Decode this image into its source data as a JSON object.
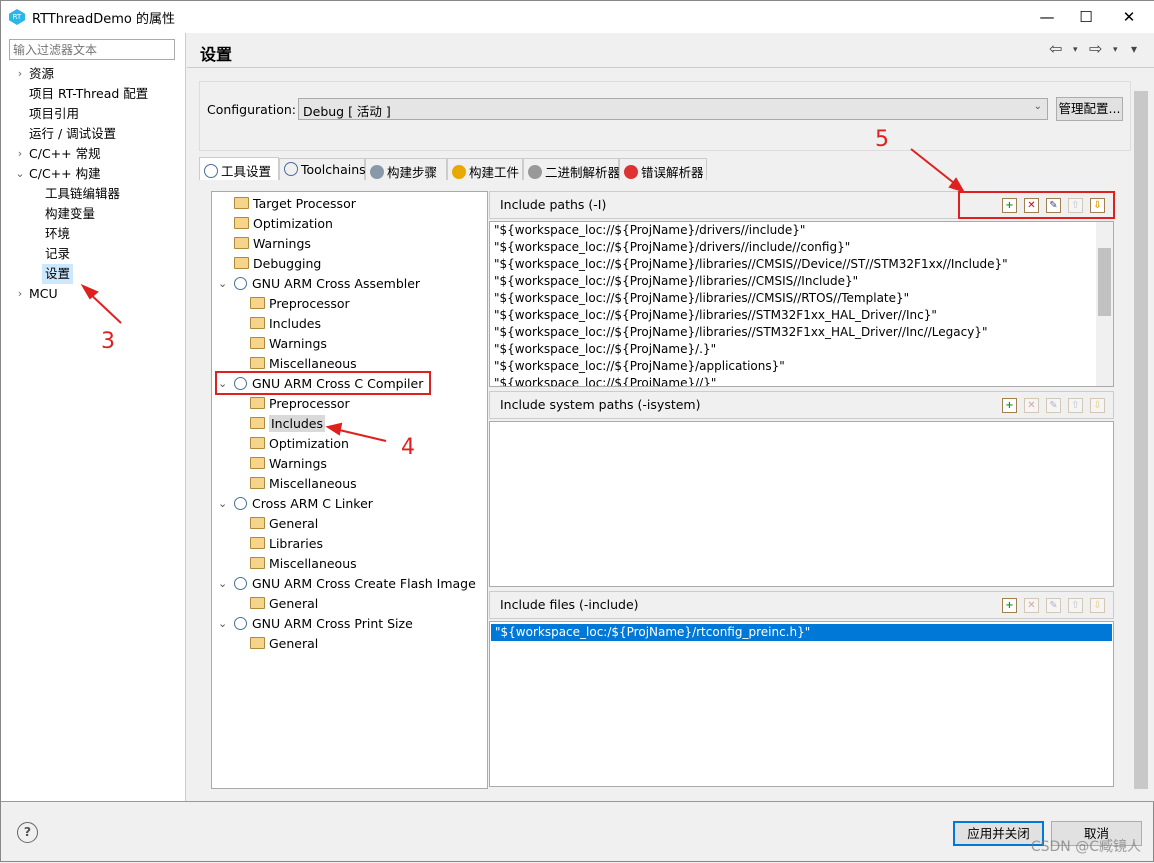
{
  "window": {
    "title": "RTThreadDemo 的属性",
    "minimize": "—",
    "maximize": "☐",
    "close": "✕"
  },
  "filter": {
    "placeholder": "输入过滤器文本"
  },
  "nav": [
    {
      "label": "资源",
      "level": 0,
      "chevron": "›"
    },
    {
      "label": "项目 RT-Thread 配置",
      "level": 0,
      "chevron": ""
    },
    {
      "label": "项目引用",
      "level": 0,
      "chevron": ""
    },
    {
      "label": "运行 / 调试设置",
      "level": 0,
      "chevron": ""
    },
    {
      "label": "C/C++ 常规",
      "level": 0,
      "chevron": "›"
    },
    {
      "label": "C/C++ 构建",
      "level": 0,
      "chevron": "⌄"
    },
    {
      "label": "工具链编辑器",
      "level": 1,
      "chevron": ""
    },
    {
      "label": "构建变量",
      "level": 1,
      "chevron": ""
    },
    {
      "label": "环境",
      "level": 1,
      "chevron": ""
    },
    {
      "label": "记录",
      "level": 1,
      "chevron": ""
    },
    {
      "label": "设置",
      "level": 1,
      "chevron": "",
      "selected": true
    },
    {
      "label": "MCU",
      "level": 0,
      "chevron": "›"
    }
  ],
  "header": {
    "title": "设置",
    "back": "⇦",
    "forward": "⇨",
    "menu": "▾"
  },
  "config": {
    "label": "Configuration:",
    "value": "Debug  [ 活动 ]",
    "manage": "管理配置..."
  },
  "tabs": [
    {
      "label": "工具设置",
      "icon": "tool-settings-icon",
      "active": true
    },
    {
      "label": "Toolchains",
      "icon": "toolchains-icon"
    },
    {
      "label": "构建步骤",
      "icon": "build-steps-icon"
    },
    {
      "label": "构建工件",
      "icon": "build-artifact-icon"
    },
    {
      "label": "二进制解析器",
      "icon": "binary-parser-icon"
    },
    {
      "label": "错误解析器",
      "icon": "error-parser-icon"
    }
  ],
  "tool_tree": [
    {
      "label": "Target Processor",
      "level": 1
    },
    {
      "label": "Optimization",
      "level": 1
    },
    {
      "label": "Warnings",
      "level": 1
    },
    {
      "label": "Debugging",
      "level": 1
    },
    {
      "label": "GNU ARM Cross Assembler",
      "level": 0
    },
    {
      "label": "Preprocessor",
      "level": 2
    },
    {
      "label": "Includes",
      "level": 2
    },
    {
      "label": "Warnings",
      "level": 2
    },
    {
      "label": "Miscellaneous",
      "level": 2
    },
    {
      "label": "GNU ARM Cross C Compiler",
      "level": 0,
      "boxed": true
    },
    {
      "label": "Preprocessor",
      "level": 2
    },
    {
      "label": "Includes",
      "level": 2,
      "selected": true
    },
    {
      "label": "Optimization",
      "level": 2
    },
    {
      "label": "Warnings",
      "level": 2
    },
    {
      "label": "Miscellaneous",
      "level": 2
    },
    {
      "label": "Cross ARM C Linker",
      "level": 0
    },
    {
      "label": "General",
      "level": 2
    },
    {
      "label": "Libraries",
      "level": 2
    },
    {
      "label": "Miscellaneous",
      "level": 2
    },
    {
      "label": "GNU ARM Cross Create Flash Image",
      "level": 0
    },
    {
      "label": "General",
      "level": 2
    },
    {
      "label": "GNU ARM Cross Print Size",
      "level": 0
    },
    {
      "label": "General",
      "level": 2
    }
  ],
  "sections": [
    {
      "title": "Include paths (-I)",
      "enabled": true,
      "items": [
        "\"${workspace_loc://${ProjName}/drivers//include}\"",
        "\"${workspace_loc://${ProjName}/drivers//include//config}\"",
        "\"${workspace_loc://${ProjName}/libraries//CMSIS//Device//ST//STM32F1xx//Include}\"",
        "\"${workspace_loc://${ProjName}/libraries//CMSIS//Include}\"",
        "\"${workspace_loc://${ProjName}/libraries//CMSIS//RTOS//Template}\"",
        "\"${workspace_loc://${ProjName}/libraries//STM32F1xx_HAL_Driver//Inc}\"",
        "\"${workspace_loc://${ProjName}/libraries//STM32F1xx_HAL_Driver//Inc//Legacy}\"",
        "\"${workspace_loc://${ProjName}/.}\"",
        "\"${workspace_loc://${ProjName}/applications}\"",
        "\"${workspace_loc://${ProjName}//}\""
      ]
    },
    {
      "title": "Include system paths (-isystem)",
      "enabled": false,
      "items": []
    },
    {
      "title": "Include files (-include)",
      "enabled": false,
      "items": [
        "\"${workspace_loc:/${ProjName}/rtconfig_preinc.h}\""
      ]
    }
  ],
  "section_tools": [
    "add-icon",
    "delete-icon",
    "edit-icon",
    "move-up-icon",
    "move-down-icon"
  ],
  "footer": {
    "help": "?",
    "apply_close": "应用并关闭",
    "cancel": "取消",
    "watermark": "CSDN @C臧镜人"
  },
  "annotations": {
    "n3": "3",
    "n4": "4",
    "n5": "5",
    "color": "#e0201f"
  }
}
